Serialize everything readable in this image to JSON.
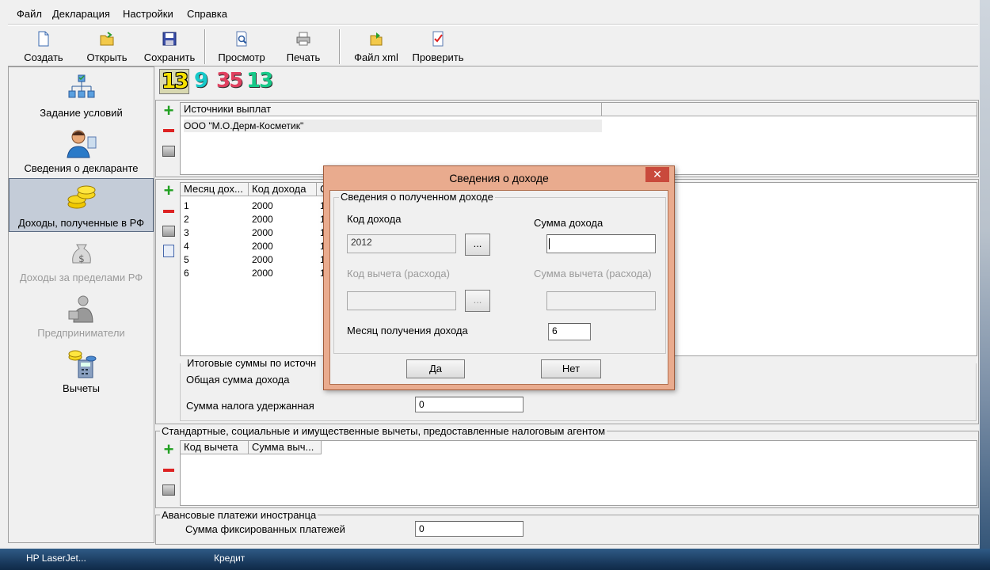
{
  "menu": [
    "Файл",
    "Декларация",
    "Настройки",
    "Справка"
  ],
  "toolbar": {
    "create": "Создать",
    "open": "Открыть",
    "save": "Сохранить",
    "preview": "Просмотр",
    "print": "Печать",
    "xml": "Файл xml",
    "check": "Проверить"
  },
  "sidebar": [
    {
      "label": "Задание условий",
      "state": "normal"
    },
    {
      "label": "Сведения о декларанте",
      "state": "normal"
    },
    {
      "label": "Доходы, полученные в РФ",
      "state": "active"
    },
    {
      "label": "Доходы за пределами РФ",
      "state": "disabled"
    },
    {
      "label": "Предприниматели",
      "state": "disabled"
    },
    {
      "label": "Вычеты",
      "state": "normal"
    }
  ],
  "counters": [
    "13",
    "9",
    "35",
    "13"
  ],
  "sources": {
    "header": "Источники выплат",
    "rows": [
      "ООО \"М.О.Дерм-Косметик\""
    ]
  },
  "income_table": {
    "headers": [
      "Месяц дох...",
      "Код дохода",
      "С"
    ],
    "rows": [
      [
        "1",
        "2000",
        "1"
      ],
      [
        "2",
        "2000",
        "1"
      ],
      [
        "3",
        "2000",
        "1"
      ],
      [
        "4",
        "2000",
        "1"
      ],
      [
        "5",
        "2000",
        "1"
      ],
      [
        "6",
        "2000",
        "1"
      ]
    ]
  },
  "totals": {
    "caption": "Итоговые суммы по источн",
    "total_income_label": "Общая сумма дохода",
    "tax_withheld_label": "Сумма налога удержанная",
    "tax_withheld_value": "0"
  },
  "deductions": {
    "caption": "Стандартные, социальные и имущественные вычеты, предоставленные налоговым агентом",
    "headers": [
      "Код вычета",
      "Сумма выч..."
    ]
  },
  "advance": {
    "caption": "Авансовые платежи иностранца",
    "label": "Сумма фиксированных платежей",
    "value": "0"
  },
  "dialog": {
    "title": "Сведения о доходе",
    "close": "✕",
    "group": "Сведения о полученном доходе",
    "income_code_label": "Код дохода",
    "income_code_value": "2012",
    "browse": "...",
    "income_amount_label": "Сумма дохода",
    "income_amount_value": "",
    "deduction_code_label": "Код вычета (расхода)",
    "deduction_amount_label": "Сумма вычета (расхода)",
    "month_label": "Месяц получения дохода",
    "month_value": "6",
    "yes": "Да",
    "no": "Нет"
  },
  "taskbar": [
    "HP LaserJet...",
    "Кредит"
  ]
}
